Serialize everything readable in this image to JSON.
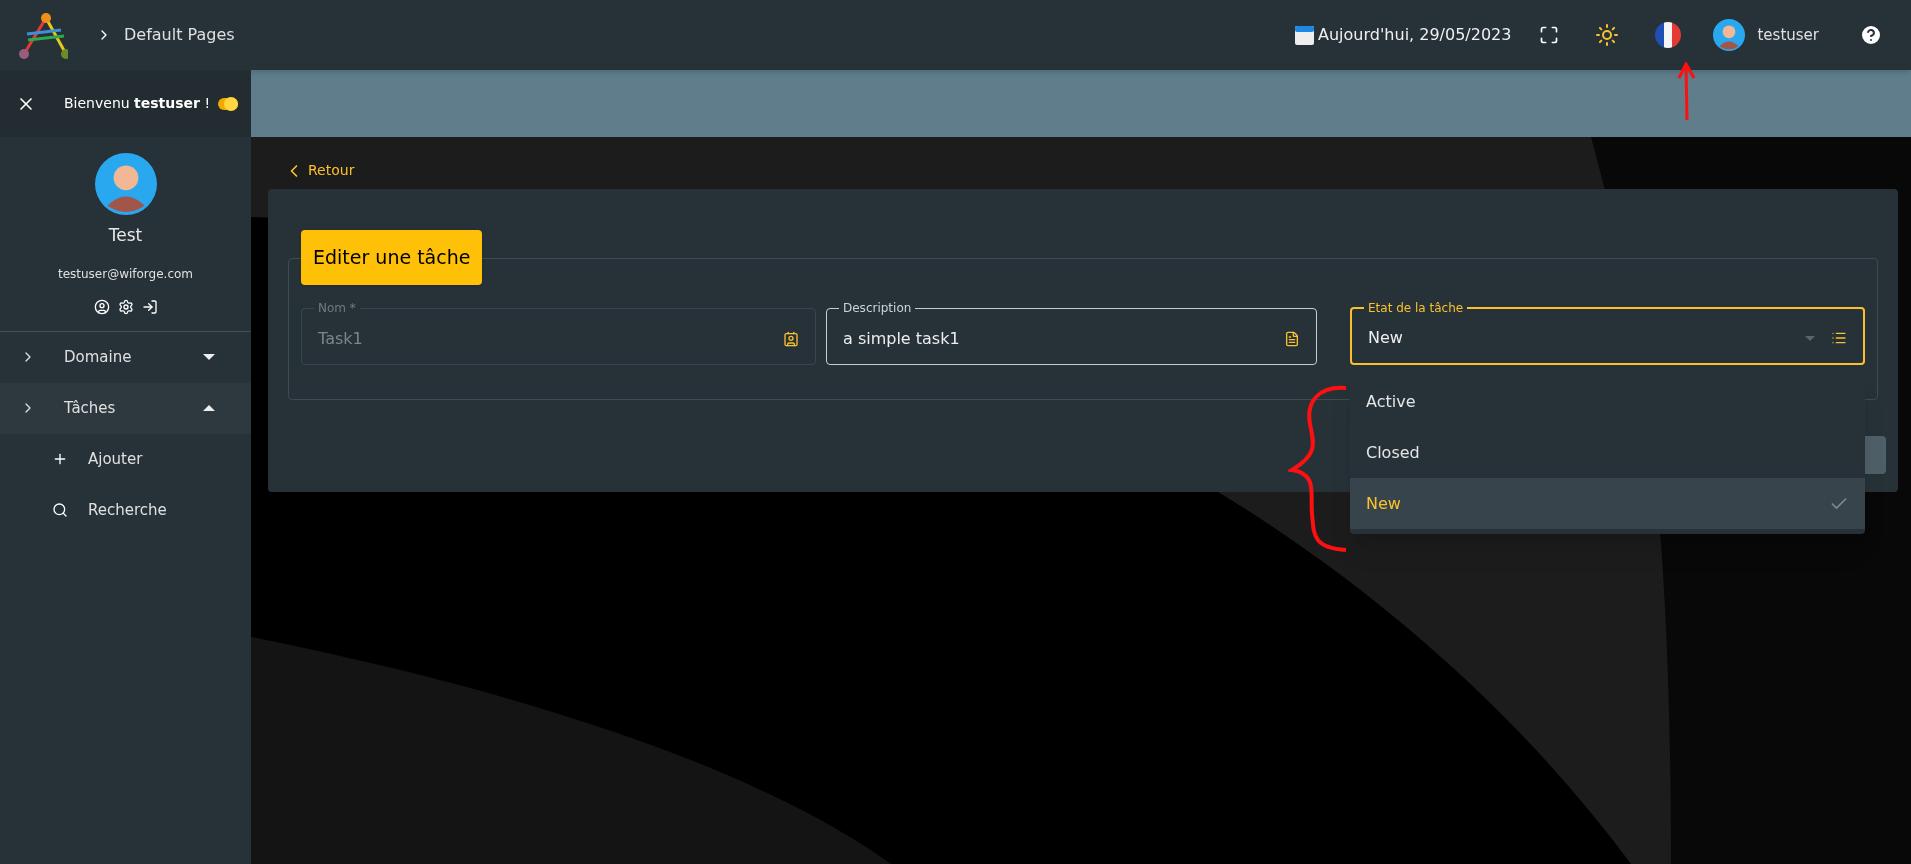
{
  "topbar": {
    "breadcrumb": "Default Pages",
    "date": "Aujourd'hui, 29/05/2023",
    "user": "testuser"
  },
  "sidebar": {
    "welcome": "Bienvenu **testuser** !",
    "toggle_on": true,
    "profile": {
      "name": "Test",
      "email": "testuser@wiforge.com"
    },
    "menu": [
      {
        "label": "Domaine",
        "expanded": false
      },
      {
        "label": "Tâches",
        "expanded": true,
        "children": [
          {
            "label": "Ajouter",
            "kind": "add"
          },
          {
            "label": "Recherche",
            "kind": "search"
          }
        ]
      }
    ]
  },
  "form": {
    "back": "Retour",
    "title": "Editer une tâche",
    "fields": [
      {
        "kind": "text",
        "label": "Nom *",
        "value": "Task1",
        "disabled": true,
        "focused": false
      },
      {
        "kind": "text",
        "label": "Description",
        "value": "a simple task1",
        "disabled": false,
        "focused": false
      },
      {
        "kind": "select",
        "label": "Etat de la tâche",
        "value": "New",
        "disabled": false,
        "focused": true
      }
    ],
    "options": [
      {
        "label": "Active",
        "selected": false
      },
      {
        "label": "Closed",
        "selected": false
      },
      {
        "label": "New",
        "selected": true
      }
    ]
  }
}
